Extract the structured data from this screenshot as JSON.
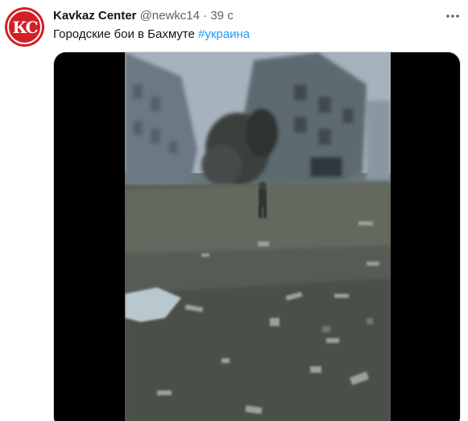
{
  "tweet": {
    "avatar_text": "КС",
    "author_name": "Kavkaz Center",
    "author_handle": "@newkc14",
    "separator": "·",
    "timestamp": "39 с",
    "text": "Городские бои в Бахмуте ",
    "hashtag": "#украина",
    "more_icon": "more-horizontal-icon"
  },
  "media": {
    "type": "video",
    "scene": "Blurry street scene with damaged buildings and debris-covered ground"
  },
  "colors": {
    "name": "#0f1419",
    "secondary": "#536471",
    "link": "#1d9bf0",
    "avatar": "#d31f26"
  }
}
